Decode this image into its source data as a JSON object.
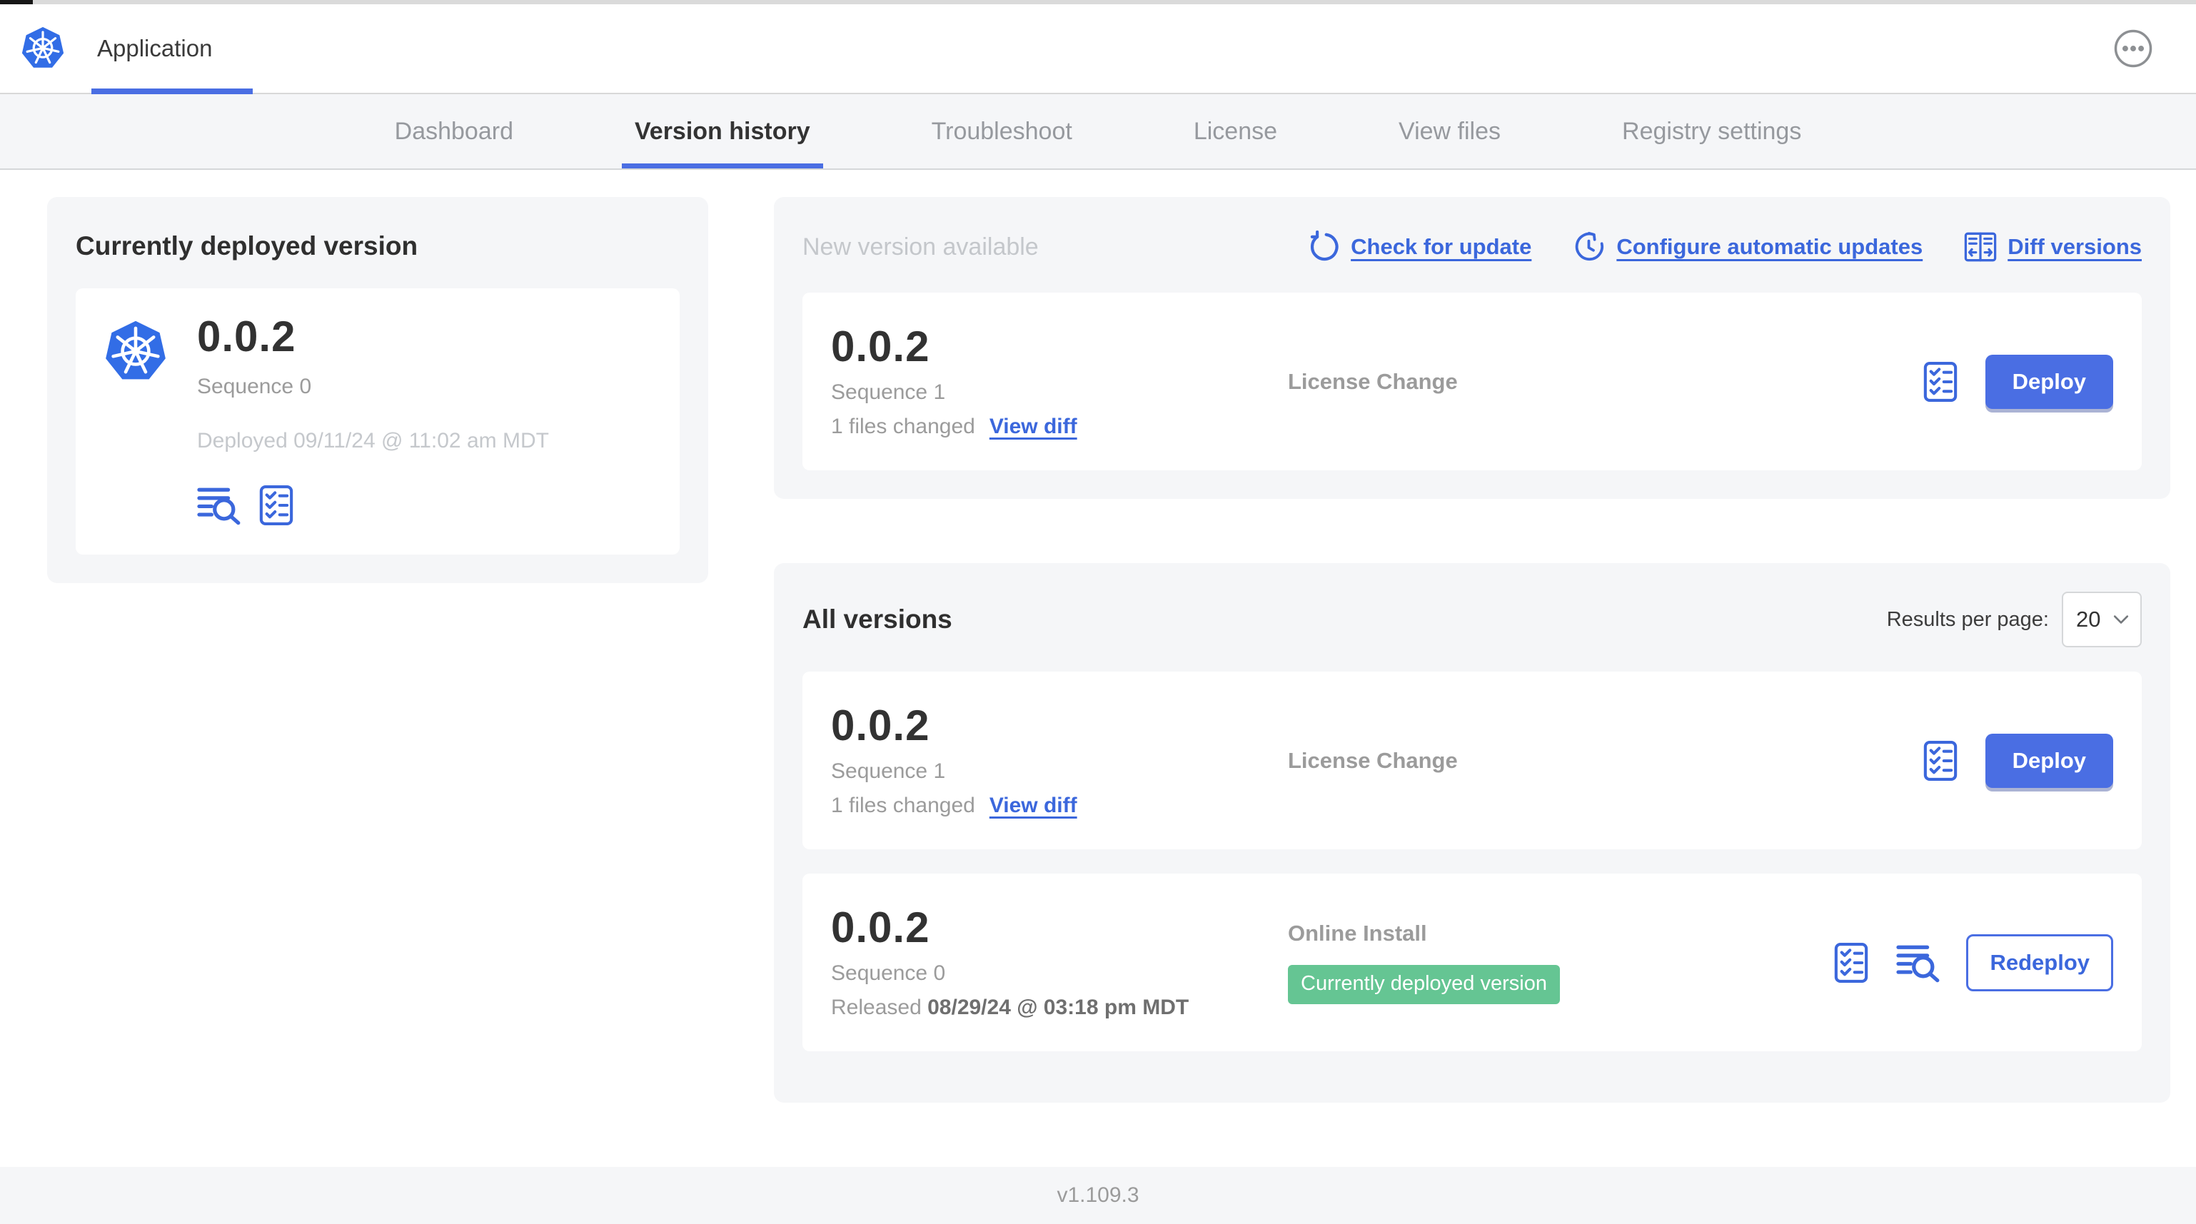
{
  "header": {
    "app_title": "Application"
  },
  "nav": {
    "tabs": [
      {
        "label": "Dashboard"
      },
      {
        "label": "Version history"
      },
      {
        "label": "Troubleshoot"
      },
      {
        "label": "License"
      },
      {
        "label": "View files"
      },
      {
        "label": "Registry settings"
      }
    ]
  },
  "deployed_card": {
    "title": "Currently deployed version",
    "version": "0.0.2",
    "sequence": "Sequence 0",
    "deployed_at": "Deployed 09/11/24 @ 11:02 am MDT"
  },
  "new_version": {
    "title": "New version available",
    "actions": [
      {
        "label": "Check for update"
      },
      {
        "label": "Configure automatic updates"
      },
      {
        "label": "Diff versions"
      }
    ],
    "row": {
      "version": "0.0.2",
      "sequence": "Sequence 1",
      "files_changed": "1 files changed",
      "view_diff_label": "View diff",
      "source": "License Change",
      "action_label": "Deploy"
    }
  },
  "all_versions": {
    "title": "All versions",
    "results_per_page_label": "Results per page:",
    "results_per_page_value": "20",
    "rows": [
      {
        "version": "0.0.2",
        "sequence": "Sequence 1",
        "files_changed": "1 files changed",
        "view_diff_label": "View diff",
        "source": "License Change",
        "action_label": "Deploy"
      },
      {
        "version": "0.0.2",
        "sequence": "Sequence 0",
        "released_prefix": "Released",
        "released_date": "08/29/24 @ 03:18 pm MDT",
        "source": "Online Install",
        "badge": "Currently deployed version",
        "action_label": "Redeploy"
      }
    ]
  },
  "footer": {
    "console_version": "v1.109.3"
  },
  "icons": {
    "app_logo": "kubernetes-wheel",
    "more_menu": "circled-ellipsis",
    "view_logs": "lines-with-magnifier",
    "preflight": "checklist-clipboard",
    "check_update": "circular-refresh-arrow",
    "auto_update": "clock-refresh",
    "diff_versions": "split-pane-diff",
    "select_chevron": "chevron-down"
  },
  "colors": {
    "accent_blue": "#3b67dc",
    "button_blue": "#4a6ee3",
    "badge_green": "#65c593",
    "panel_gray": "#f5f6f8",
    "text_dark": "#323232",
    "text_muted": "#9b9b9b",
    "text_light": "#c5c8cc"
  }
}
